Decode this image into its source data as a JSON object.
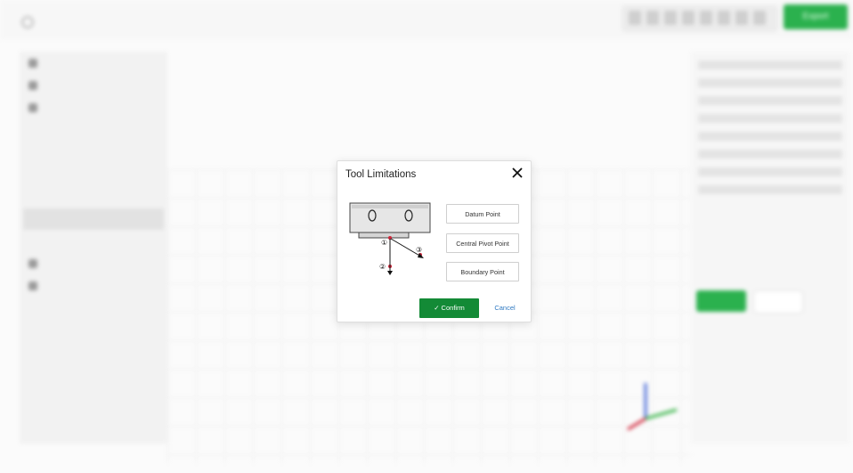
{
  "dialog": {
    "title": "Tool Limitations",
    "options": {
      "datum": "Datum Point",
      "central_pivot": "Central Pivot Point",
      "boundary": "Boundary Point"
    },
    "confirm_label": "✓ Confirm",
    "cancel_label": "Cancel",
    "diagram_markers": [
      "①",
      "②",
      "③"
    ]
  },
  "background": {
    "export_label": "Export"
  },
  "colors": {
    "confirm_green": "#138a36",
    "cancel_blue": "#2f79c2",
    "marker_red": "#d0253a"
  }
}
